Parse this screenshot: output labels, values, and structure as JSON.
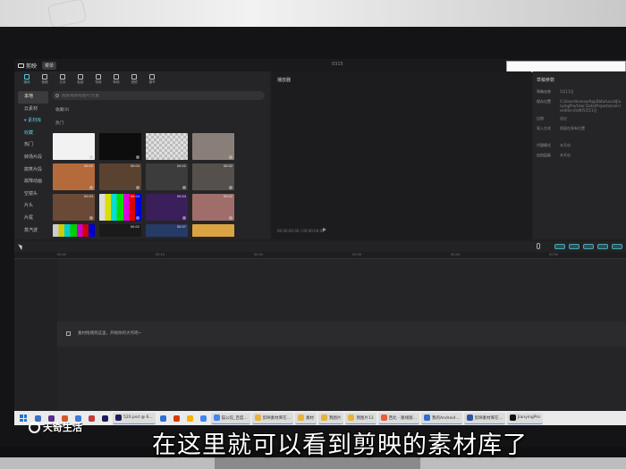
{
  "app": {
    "title": "剪映",
    "menu_label": "菜单",
    "window_title": "0315"
  },
  "toolbar": [
    {
      "label": "媒体",
      "icon": "media-icon",
      "active": true
    },
    {
      "label": "音频",
      "icon": "audio-icon"
    },
    {
      "label": "文本",
      "icon": "text-icon"
    },
    {
      "label": "贴纸",
      "icon": "sticker-icon"
    },
    {
      "label": "特效",
      "icon": "effects-icon"
    },
    {
      "label": "转场",
      "icon": "transition-icon"
    },
    {
      "label": "滤镜",
      "icon": "filter-icon"
    },
    {
      "label": "调节",
      "icon": "adjust-icon"
    }
  ],
  "categories": [
    {
      "label": "本地",
      "state": "active"
    },
    {
      "label": "云素材",
      "state": ""
    },
    {
      "label": "▾ 素材库",
      "state": "accent"
    },
    {
      "label": "收藏",
      "state": "accent"
    },
    {
      "label": "热门",
      "state": ""
    },
    {
      "label": "转场片段",
      "state": ""
    },
    {
      "label": "搞笑片段",
      "state": ""
    },
    {
      "label": "故障动画",
      "state": ""
    },
    {
      "label": "空镜头",
      "state": ""
    },
    {
      "label": "片头",
      "state": ""
    },
    {
      "label": "片尾",
      "state": ""
    },
    {
      "label": "蒸汽波",
      "state": ""
    }
  ],
  "search": {
    "placeholder": "搜索视频或图片/元素"
  },
  "sections": {
    "favorites": "收藏(0)",
    "hot": "热门"
  },
  "thumbnails": [
    {
      "duration": "",
      "color": "#f2f2f2"
    },
    {
      "duration": "",
      "color": "#0d0d0d"
    },
    {
      "duration": "",
      "color": "#c8c8c8"
    },
    {
      "duration": "",
      "color": "#8a7f78"
    },
    {
      "duration": "00:02",
      "color": "#b46a3a"
    },
    {
      "duration": "00:04",
      "color": "#5a4230"
    },
    {
      "duration": "00:02",
      "color": "#3c3c3c"
    },
    {
      "duration": "00:02",
      "color": "#55504c"
    },
    {
      "duration": "00:04",
      "color": "#6a4a36"
    },
    {
      "duration": "00:04",
      "color": "#777777"
    },
    {
      "duration": "00:04",
      "color": "#3a1f5a"
    },
    {
      "duration": "00:02",
      "color": "#a06e6a"
    },
    {
      "duration": "",
      "color": "#8c8c44"
    },
    {
      "duration": "00:02",
      "color": "#1a1a1a"
    },
    {
      "duration": "00:07",
      "color": "#263a66"
    },
    {
      "duration": "",
      "color": "#d9a441"
    }
  ],
  "player": {
    "title": "播放器",
    "time": "00:00:00:00 / 00:00:00:00"
  },
  "props": {
    "title": "草稿参数",
    "rows": [
      {
        "k": "草稿名称",
        "v": "5月11日"
      },
      {
        "k": "保存位置",
        "v": "C:/Users/lenovo/AppData/Local/JianyingPro/User Data/Projects/com.lveditor.draft/5月11日"
      },
      {
        "k": "比例",
        "v": "适应"
      },
      {
        "k": "导入方式",
        "v": "保留在原有位置"
      },
      {
        "k": "代理模式",
        "v": "未开启"
      },
      {
        "k": "自由层级",
        "v": "未开启"
      }
    ]
  },
  "timeline": {
    "ticks": [
      "00:00",
      "00:10",
      "00:20",
      "00:30",
      "00:40",
      "00:50"
    ],
    "drag_hint": "素材拖拽到这里，开始你的大作吧~"
  },
  "taskbar": {
    "items": [
      {
        "label": "",
        "color": "#3b6fc4"
      },
      {
        "label": "",
        "color": "#5b2d8a"
      },
      {
        "label": "",
        "color": "#d4582b"
      },
      {
        "label": "",
        "color": "#3a7ad6"
      },
      {
        "label": "",
        "color": "#c43a3a"
      },
      {
        "label": "",
        "color": "#1c1c5a"
      },
      {
        "label": "520.psd @ 6...",
        "color": "#1c1c5a"
      },
      {
        "label": "",
        "color": "#2f6fd0"
      },
      {
        "label": "",
        "color": "#d83b01"
      },
      {
        "label": "",
        "color": "#f4b400"
      },
      {
        "label": "",
        "color": "#4285f4"
      },
      {
        "label": "猫公馆_百度...",
        "color": "#4285f4"
      },
      {
        "label": "剪映素材库在...",
        "color": "#e8b33a"
      },
      {
        "label": "素材",
        "color": "#e8b33a"
      },
      {
        "label": "我图片",
        "color": "#e8b33a"
      },
      {
        "label": "我图片13",
        "color": "#e8b33a"
      },
      {
        "label": "西北 - 路线版...",
        "color": "#e85d3a"
      },
      {
        "label": "我的Android...",
        "color": "#2f6fd0"
      },
      {
        "label": "剪映素材库在...",
        "color": "#2b579a"
      },
      {
        "label": "JianyingPro",
        "color": "#111111"
      }
    ]
  },
  "subtitle": "在这里就可以看到剪映的素材库了",
  "watermark": "天奇生活"
}
